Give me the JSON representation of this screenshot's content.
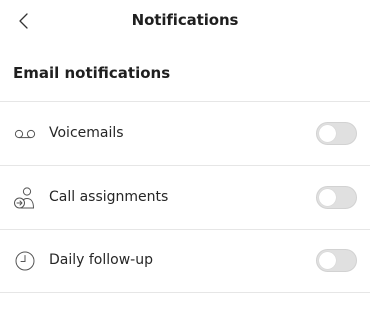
{
  "header": {
    "title": "Notifications"
  },
  "section": {
    "title": "Email notifications"
  },
  "items": [
    {
      "label": "Voicemails",
      "icon": "voicemail-icon",
      "enabled": false
    },
    {
      "label": "Call assignments",
      "icon": "assign-person-icon",
      "enabled": false
    },
    {
      "label": "Daily follow-up",
      "icon": "clock-icon",
      "enabled": false
    }
  ],
  "colors": {
    "toggle_off": "#e0e0e0",
    "divider": "#e6e6e6"
  }
}
